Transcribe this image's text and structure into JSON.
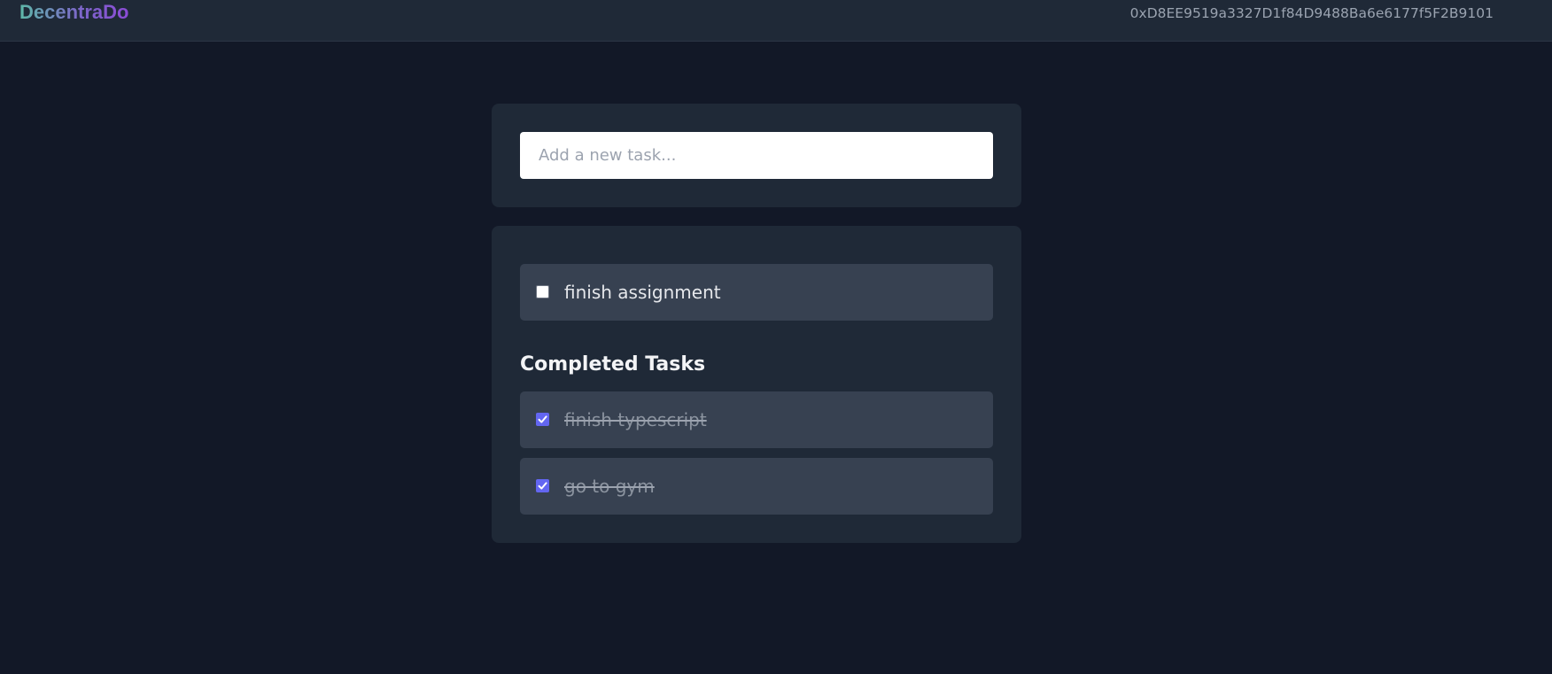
{
  "header": {
    "logo": "DecentraDo",
    "wallet_address": "0xD8EE9519a3327D1f84D9488Ba6e6177f5F2B9101"
  },
  "new_task": {
    "placeholder": "Add a new task..."
  },
  "pending_tasks": [
    {
      "text": "finish assignment",
      "completed": false
    }
  ],
  "completed_section": {
    "title": "Completed Tasks",
    "tasks": [
      {
        "text": "finish typescript",
        "completed": true
      },
      {
        "text": "go to gym",
        "completed": true
      }
    ]
  },
  "colors": {
    "background": "#121827",
    "card": "#1f2937",
    "task_row": "#374151",
    "checkbox_checked": "#6366f1"
  },
  "icons": {
    "checkbox_checked": "check-icon"
  }
}
